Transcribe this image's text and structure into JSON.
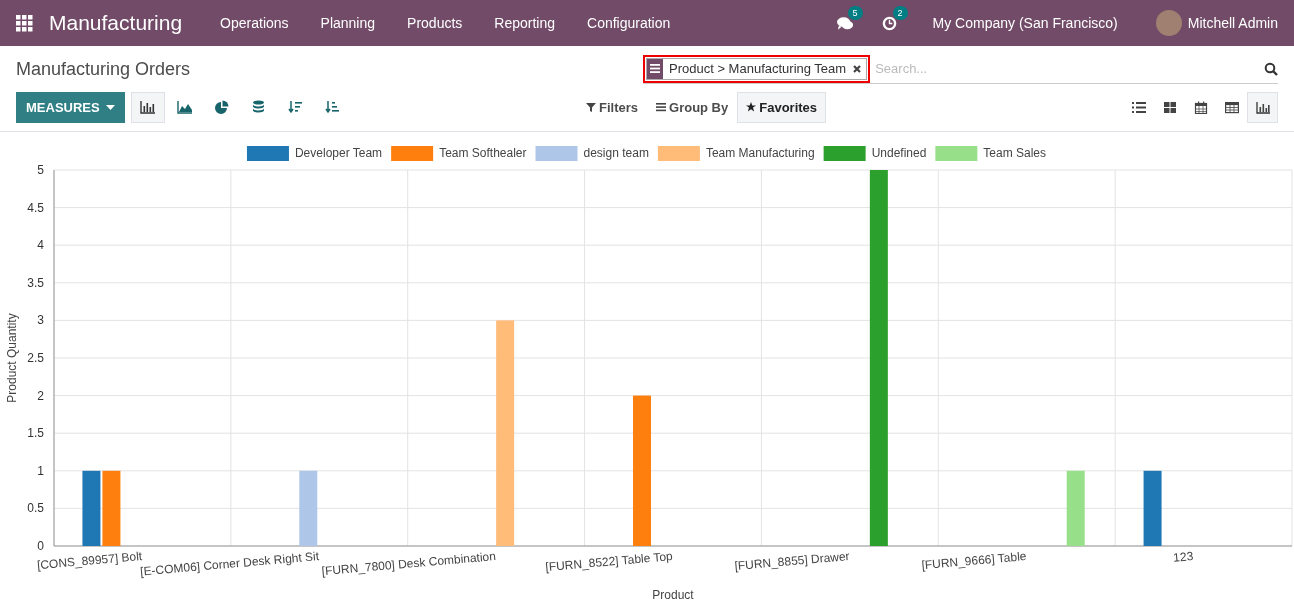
{
  "navbar": {
    "app_name": "Manufacturing",
    "menu": [
      "Operations",
      "Planning",
      "Products",
      "Reporting",
      "Configuration"
    ],
    "messages_count": "5",
    "activities_count": "2",
    "company": "My Company (San Francisco)",
    "user": "Mitchell Admin"
  },
  "control_panel": {
    "title": "Manufacturing Orders",
    "facet": {
      "label": "Product > Manufacturing Team"
    },
    "search": {
      "placeholder": "Search..."
    },
    "measures_label": "MEASURES",
    "graph_tools": [
      {
        "kind": "bar",
        "selected": true
      },
      {
        "kind": "line",
        "selected": false
      },
      {
        "kind": "pie",
        "selected": false
      },
      {
        "kind": "stacked",
        "selected": false
      },
      {
        "kind": "sort_desc",
        "selected": false
      },
      {
        "kind": "sort_asc",
        "selected": false
      }
    ],
    "search_options": [
      {
        "kind": "filter",
        "label": "Filters",
        "selected": false
      },
      {
        "kind": "group",
        "label": "Group By",
        "selected": false
      },
      {
        "kind": "favorite",
        "label": "Favorites",
        "selected": true
      }
    ],
    "views": [
      {
        "kind": "list",
        "selected": false
      },
      {
        "kind": "kanban",
        "selected": false
      },
      {
        "kind": "calendar",
        "selected": false
      },
      {
        "kind": "pivot",
        "selected": false
      },
      {
        "kind": "graph",
        "selected": true
      }
    ]
  },
  "chart": {
    "chart_data": {
      "type": "bar",
      "xlabel": "Product",
      "ylabel": "Product Quantity",
      "categories": [
        "[CONS_89957] Bolt",
        "[E-COM06] Corner Desk Right Sit",
        "[FURN_7800] Desk Combination",
        "[FURN_8522] Table Top",
        "[FURN_8855] Drawer",
        "[FURN_9666] Table",
        "123"
      ],
      "series": [
        {
          "name": "Developer Team",
          "color": "#1f77b4",
          "values": [
            1,
            null,
            null,
            null,
            null,
            null,
            1
          ]
        },
        {
          "name": "Team Softhealer",
          "color": "#ff7f0e",
          "values": [
            1,
            null,
            null,
            2,
            null,
            null,
            null
          ]
        },
        {
          "name": "design team",
          "color": "#aec7e8",
          "values": [
            null,
            1,
            null,
            null,
            null,
            null,
            null
          ]
        },
        {
          "name": "Team Manufacturing",
          "color": "#ffbb78",
          "values": [
            null,
            null,
            3,
            null,
            null,
            null,
            null
          ]
        },
        {
          "name": "Undefined",
          "color": "#2ca02c",
          "values": [
            null,
            null,
            null,
            null,
            5,
            null,
            null
          ]
        },
        {
          "name": "Team Sales",
          "color": "#98df8a",
          "values": [
            null,
            null,
            null,
            null,
            null,
            1,
            null
          ]
        }
      ],
      "grid": true,
      "legend": true,
      "ylim": [
        0,
        5
      ],
      "yticks": [
        0,
        0.5,
        1,
        1.5,
        2,
        2.5,
        3,
        3.5,
        4,
        4.5,
        5
      ]
    }
  }
}
